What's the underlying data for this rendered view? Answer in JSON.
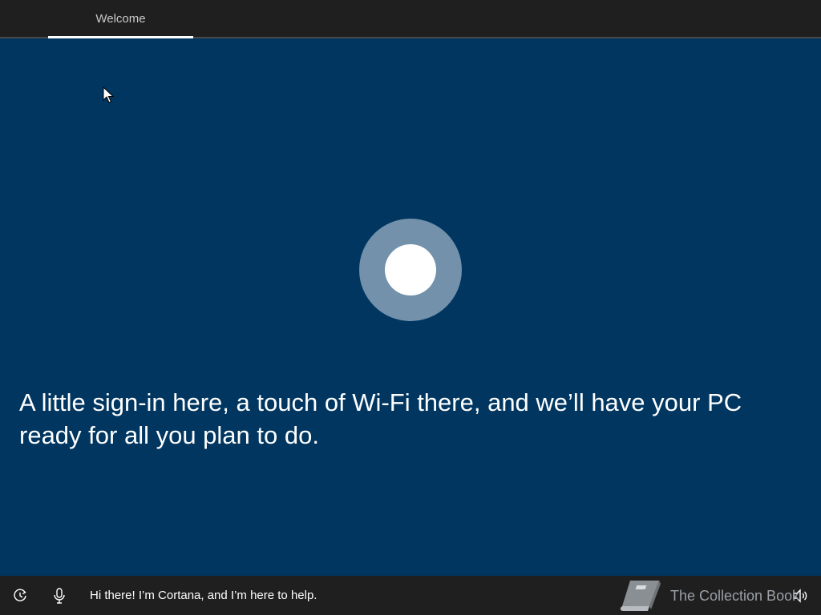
{
  "header": {
    "tabs": [
      {
        "label": "Welcome",
        "active": true
      }
    ]
  },
  "main": {
    "message": "A little sign-in here, a touch of Wi-Fi there, and we’ll have your PC ready for all you plan to do."
  },
  "footer": {
    "cortana_text": "Hi there! I’m Cortana, and I’m here to help.",
    "watermark": "The Collection Book"
  },
  "colors": {
    "background": "#003660",
    "bar": "#1f1f1f",
    "cortana_ring": "#7391aa"
  },
  "icons": {
    "ease_of_access": "ease-of-access-icon",
    "microphone": "microphone-icon",
    "volume": "volume-icon",
    "book": "book-icon",
    "cursor": "mouse-cursor-icon"
  }
}
